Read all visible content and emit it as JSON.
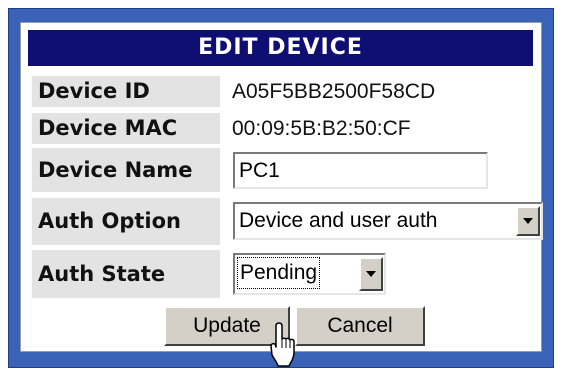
{
  "form": {
    "title": "EDIT DEVICE",
    "device_id": {
      "label": "Device ID",
      "value": "A05F5BB2500F58CD"
    },
    "device_mac": {
      "label": "Device MAC",
      "value": "00:09:5B:B2:50:CF"
    },
    "device_name": {
      "label": "Device Name",
      "value": "PC1"
    },
    "auth_option": {
      "label": "Auth Option",
      "selected": "Device and user auth"
    },
    "auth_state": {
      "label": "Auth State",
      "selected": "Pending"
    }
  },
  "buttons": {
    "update_label": "Update",
    "cancel_label": "Cancel"
  },
  "colors": {
    "frame": "#3a63b8",
    "title_bar": "#0e0e73",
    "label_bg": "#e3e3e3",
    "button_face": "#d4d0c8"
  },
  "icons": {
    "cursor": "hand-pointer-icon",
    "dropdown": "chevron-down-icon"
  }
}
